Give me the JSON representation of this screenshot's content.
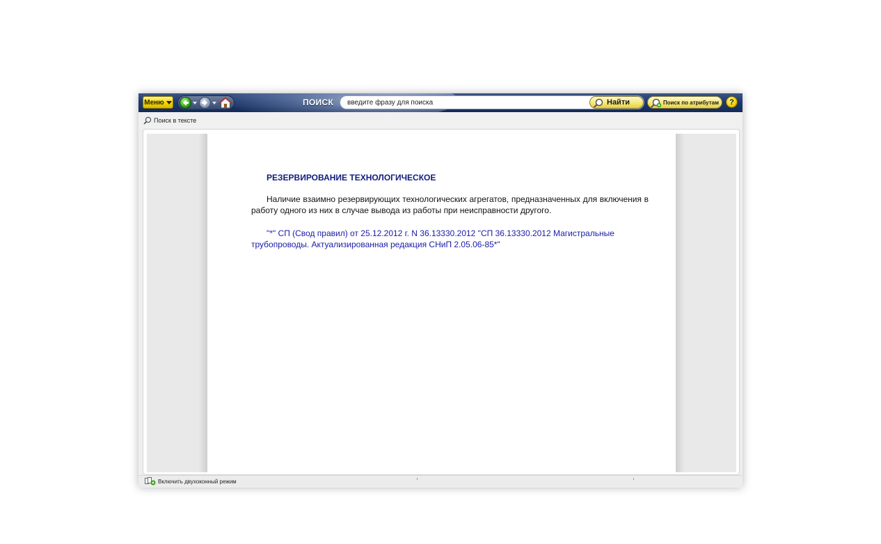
{
  "toolbar": {
    "menu_label": "Меню",
    "search_label": "ПОИСК",
    "search_placeholder": "введите фразу для поиска",
    "find_label": "Найти",
    "attr_search_label": "Поиск по атрибутам",
    "help_label": "?"
  },
  "subbar": {
    "find_in_text_label": "Поиск в тексте"
  },
  "document": {
    "title": "РЕЗЕРВИРОВАНИЕ ТЕХНОЛОГИЧЕСКОЕ",
    "body": "Наличие взаимно резервирующих технологических агрегатов, предназначенных для включения в работу одного из них в случае вывода из работы при неисправности другого.",
    "reference": "\"*\" СП (Свод правил) от 25.12.2012 г. N 36.13330.2012 \"СП 36.13330.2012 Магистральные трубопроводы. Актуализированная редакция СНиП 2.05.06-85*\""
  },
  "statusbar": {
    "two_window_label": "Включить двухоконный режим"
  },
  "icons": {
    "menu_caret": "caret-down-icon",
    "back": "arrow-left-icon",
    "forward": "arrow-right-icon",
    "home": "home-icon",
    "find": "magnifier-icon",
    "attr_search": "magnifier-plus-icon",
    "help": "question-icon",
    "find_in_text": "magnifier-icon",
    "two_window": "two-window-icon"
  },
  "colors": {
    "toolbar_bg": "#1f3a6e",
    "button_yellow": "#f1d400",
    "title_blue": "#0f1c80",
    "link_blue": "#1a1aa8"
  }
}
